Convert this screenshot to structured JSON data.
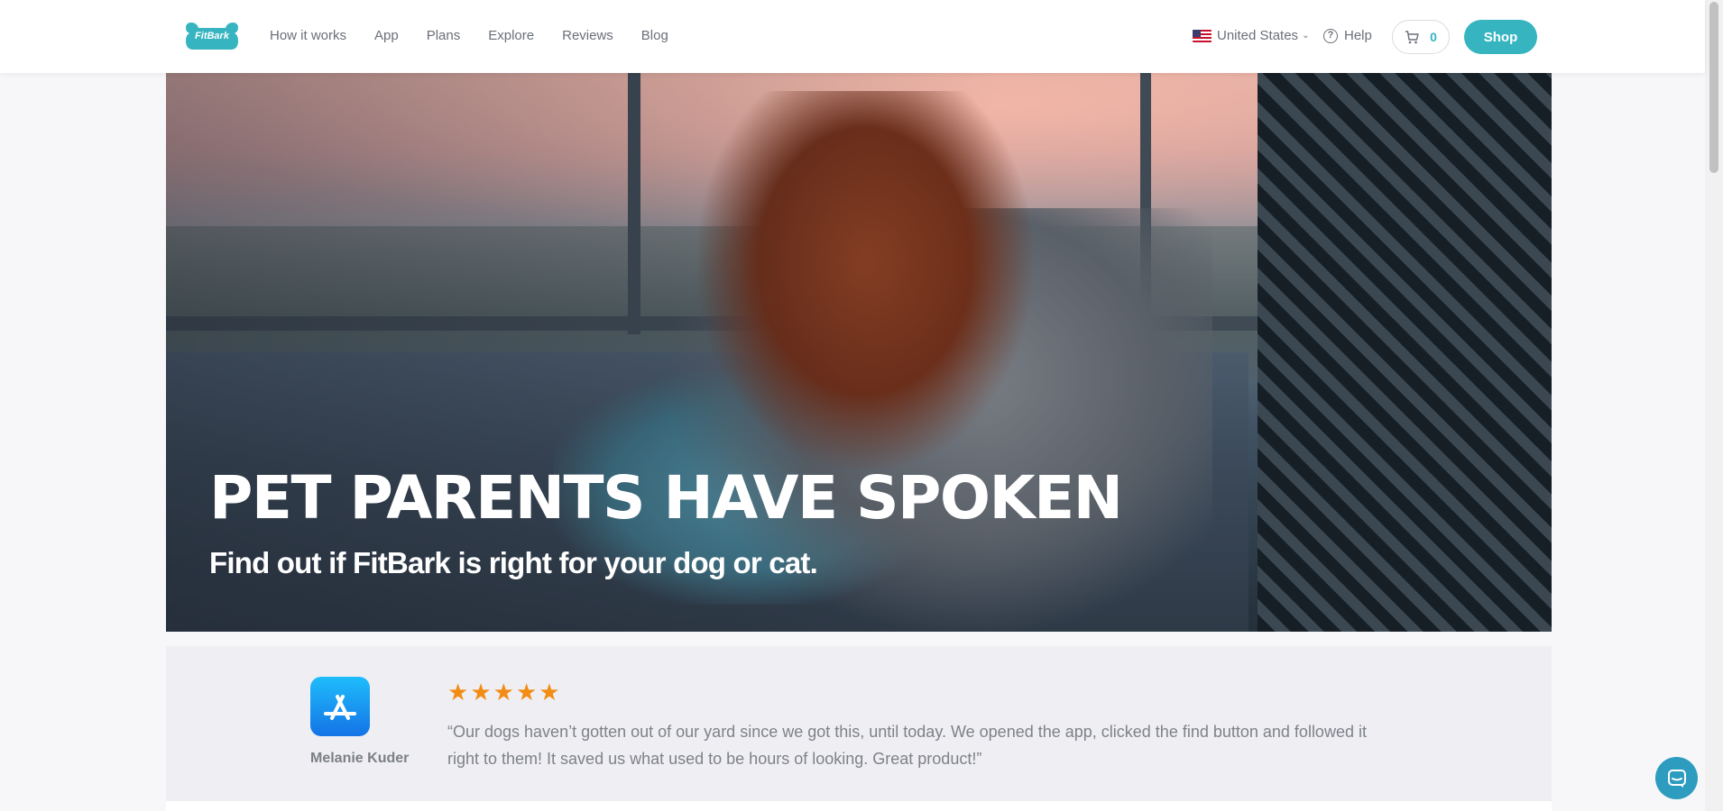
{
  "header": {
    "logo_text": "FitBark",
    "nav": [
      "How it works",
      "App",
      "Plans",
      "Explore",
      "Reviews",
      "Blog"
    ],
    "country": "United States",
    "help_label": "Help",
    "cart_count": "0",
    "shop_label": "Shop",
    "accent_color": "#36b4c0"
  },
  "hero": {
    "title": "PET PARENTS HAVE SPOKEN",
    "subtitle": "Find out if FitBark is right for your dog or cat."
  },
  "review": {
    "source_icon": "app-store-icon",
    "rating": 5,
    "reviewer": "Melanie Kuder",
    "quote": "“Our dogs haven’t gotten out of our yard since we got this, until today. We opened the app, clicked the find button and followed it right to them! It saved us what used to be hours of looking. Great product!”",
    "star_color": "#f28c14"
  },
  "chat": {
    "icon": "chat-icon"
  }
}
